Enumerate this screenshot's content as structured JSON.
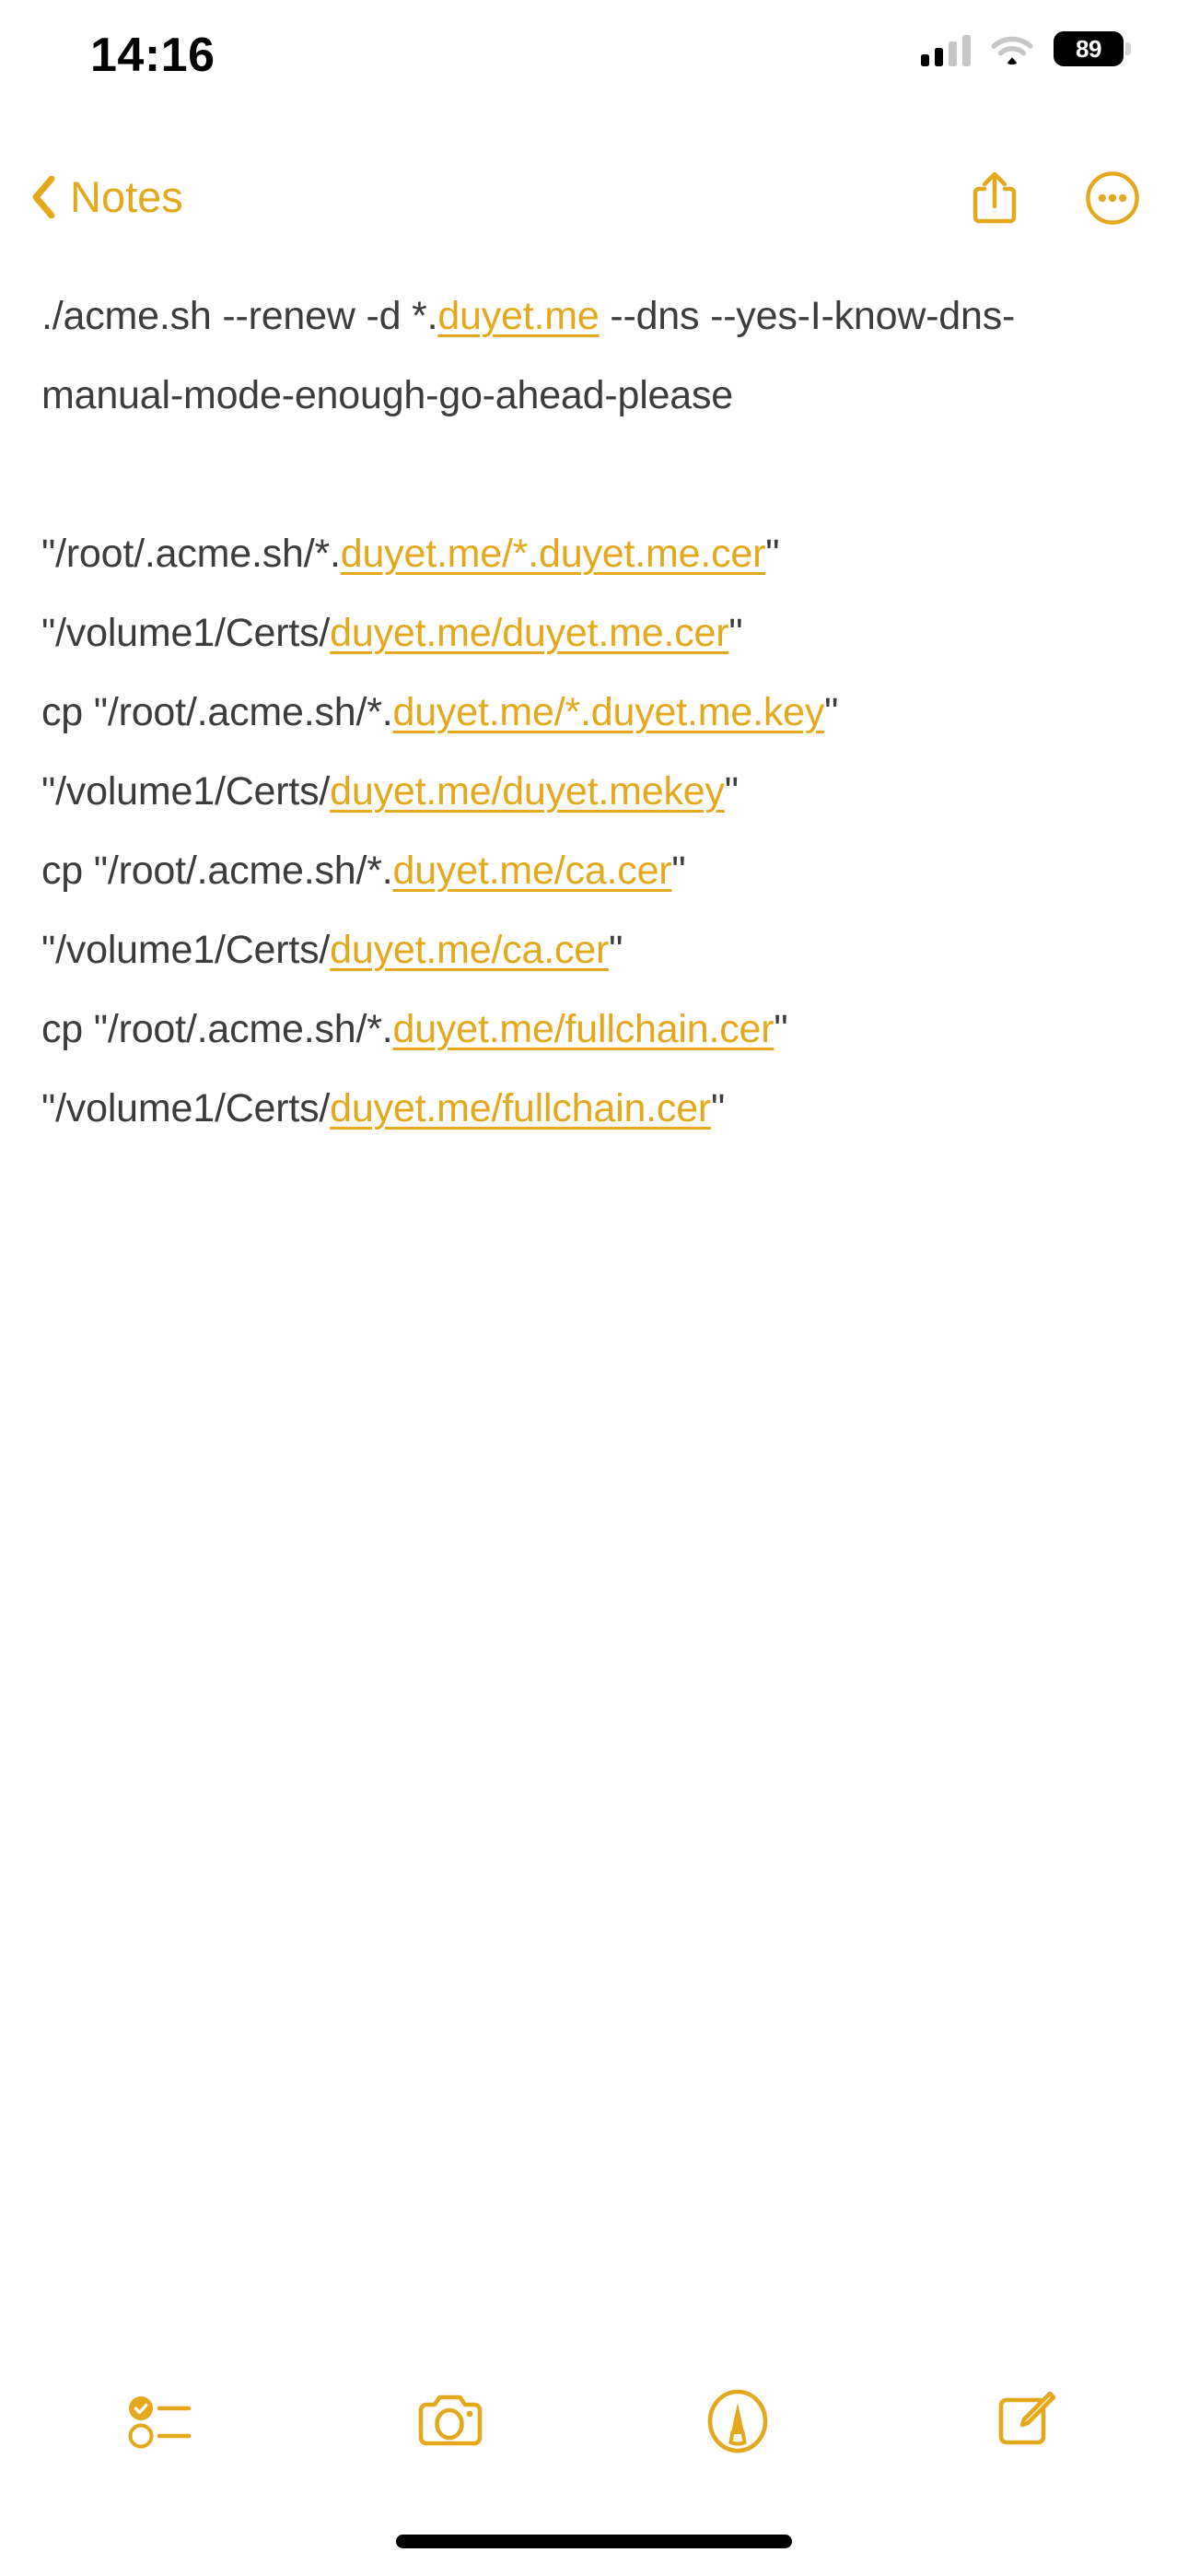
{
  "status_bar": {
    "time": "14:16",
    "battery_level": "89",
    "cellular_icon": "cellular-signal-icon",
    "wifi_icon": "wifi-icon",
    "battery_icon": "battery-icon"
  },
  "nav_bar": {
    "back_label": "Notes",
    "back_icon": "chevron-left-icon",
    "share_icon": "share-icon",
    "more_icon": "more-options-icon"
  },
  "note": {
    "paragraphs": [
      {
        "id": "command-renew",
        "segments": [
          {
            "type": "text",
            "value": "./acme.sh --renew -d *."
          },
          {
            "type": "link",
            "value": "duyet.me"
          },
          {
            "type": "text",
            "value": " --dns --yes-I-know-dns-manual-mode-enough-go-ahead-please"
          }
        ]
      },
      {
        "id": "blank-line",
        "segments": []
      },
      {
        "id": "command-cp-cer",
        "segments": [
          {
            "type": "text",
            "value": "\"/root/.acme.sh/*."
          },
          {
            "type": "link",
            "value": "duyet.me/*.duyet.me.cer"
          },
          {
            "type": "text",
            "value": "\" \"/volume1/Certs/"
          },
          {
            "type": "link",
            "value": "duyet.me/duyet.me.cer"
          },
          {
            "type": "text",
            "value": "\""
          }
        ]
      },
      {
        "id": "command-cp-key",
        "segments": [
          {
            "type": "text",
            "value": "cp \"/root/.acme.sh/*."
          },
          {
            "type": "link",
            "value": "duyet.me/*.duyet.me.key"
          },
          {
            "type": "text",
            "value": "\" \"/volume1/Certs/"
          },
          {
            "type": "link",
            "value": "duyet.me/duyet.mekey"
          },
          {
            "type": "text",
            "value": "\""
          }
        ]
      },
      {
        "id": "command-cp-ca",
        "segments": [
          {
            "type": "text",
            "value": "cp \"/root/.acme.sh/*."
          },
          {
            "type": "link",
            "value": "duyet.me/ca.cer"
          },
          {
            "type": "text",
            "value": "\" \"/volume1/Certs/"
          },
          {
            "type": "link",
            "value": "duyet.me/ca.cer"
          },
          {
            "type": "text",
            "value": "\""
          }
        ]
      },
      {
        "id": "command-cp-fullchain",
        "segments": [
          {
            "type": "text",
            "value": "cp \"/root/.acme.sh/*."
          },
          {
            "type": "link",
            "value": "duyet.me/fullchain.cer"
          },
          {
            "type": "text",
            "value": "\" \"/volume1/Certs/"
          },
          {
            "type": "link",
            "value": "duyet.me/fullchain.cer"
          },
          {
            "type": "text",
            "value": "\""
          }
        ]
      }
    ]
  },
  "toolbar": {
    "items": [
      {
        "id": "checklist",
        "icon": "checklist-icon"
      },
      {
        "id": "camera",
        "icon": "camera-icon"
      },
      {
        "id": "markup",
        "icon": "markup-pen-icon"
      },
      {
        "id": "compose",
        "icon": "compose-icon"
      }
    ]
  },
  "colors": {
    "accent": "#E3A81C",
    "text": "#3c3c3c",
    "background": "#ffffff",
    "status_text": "#000000"
  }
}
